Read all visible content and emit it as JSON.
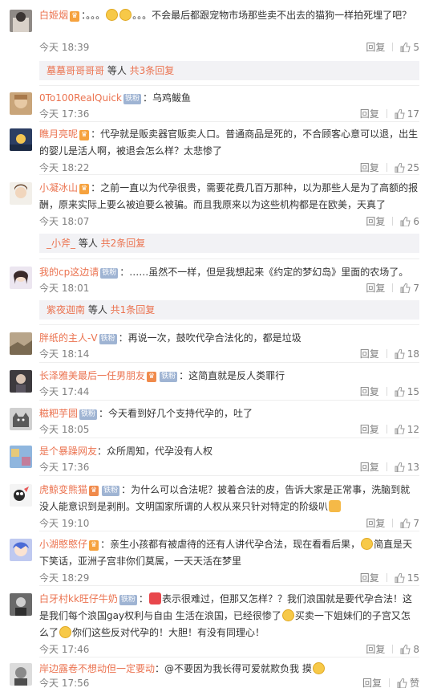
{
  "colors": {
    "username": "#eb7350",
    "meta": "#808080",
    "text": "#333333",
    "subbar_bg": "#f2f2f5"
  },
  "comments": [
    {
      "user": "白姬烟",
      "badge": "",
      "text_parts": [
        "：。。。",
        "。。。不会最后都跟宠物市场那些卖不出去的猫狗一样拍死埋了吧？"
      ],
      "time": "今天 18:39",
      "reply_label": "回复",
      "likes": "5",
      "sub": {
        "user": "墓墓哥哥哥哥",
        "middle": " 等人 ",
        "more": "共3条回复"
      }
    },
    {
      "user": "0To100RealQuick",
      "badge": "铁粉",
      "text": "：乌鸡鲅鱼",
      "time": "今天 17:36",
      "reply_label": "回复",
      "likes": "17"
    },
    {
      "user": "瞧月亮呢",
      "badge": "",
      "text": "：代孕就是贩卖器官贩卖人口。普通商品是死的，不合顾客心意可以退，出生的婴儿是活人啊，被退会怎么样？太悲惨了",
      "time": "今天 18:22",
      "reply_label": "回复",
      "likes": "25"
    },
    {
      "user": "小凝冰山",
      "badge": "",
      "text": "：之前一直以为代孕很贵，需要花费几百万那种，以为那些人是为了高额的报酬，原来实际上要么被迫要么被骗。而且我原来以为这些机构都是在欧美，天真了",
      "time": "今天 18:07",
      "reply_label": "回复",
      "likes": "6",
      "sub": {
        "user": "_小斧_",
        "middle": " 等人 ",
        "more": "共2条回复"
      }
    },
    {
      "user": "我的cp这边请",
      "badge": "铁粉",
      "text": "：……虽然不一样，但是我想起来《约定的梦幻岛》里面的农场了。",
      "time": "今天 18:01",
      "reply_label": "回复",
      "likes": "7",
      "sub": {
        "user": "紫夜迦南",
        "middle": " 等人 ",
        "more": "共1条回复"
      }
    },
    {
      "user": "胖纸的主人-V",
      "badge": "铁粉",
      "text": "：再说一次，鼓吹代孕合法化的，都是垃圾",
      "time": "今天 18:14",
      "reply_label": "回复",
      "likes": "18"
    },
    {
      "user": "长泽雅美最后一任男朋友",
      "badge": "铁粉",
      "text": "：这简直就是反人类罪行",
      "time": "今天 17:44",
      "reply_label": "回复",
      "likes": "15"
    },
    {
      "user": "糍粑芋圆",
      "badge": "铁粉",
      "text": "：今天看到好几个支持代孕的，吐了",
      "time": "今天 18:05",
      "reply_label": "回复",
      "likes": "12"
    },
    {
      "user": "是个暴躁网友",
      "badge": "",
      "text": "：众所周知，代孕没有人权",
      "time": "今天 17:36",
      "reply_label": "回复",
      "likes": "13"
    },
    {
      "user": "虎鲸变熊猫",
      "badge": "铁粉",
      "text": "：为什么可以合法呢？披着合法的皮，告诉大家是正常事，洗脑到就没人能意识到是剥削。文明国家所谓的人权从来只针对特定的阶级叭",
      "time": "今天 19:10",
      "reply_label": "回复",
      "likes": "7"
    },
    {
      "user": "小湖愍愍仔",
      "badge": "",
      "text": "：亲生小孩都有被虐待的还有人讲代孕合法，现在看看后果，",
      "text2": "简直是天下笑话，亚洲子宫非你们莫属，一天天活在梦里",
      "time": "今天 18:29",
      "reply_label": "回复",
      "likes": "15"
    },
    {
      "user": "白牙村kk旺仔牛奶",
      "badge": "铁粉",
      "text": "：",
      "text2": "表示很难过，但那又怎样？？我们浪国就是要代孕合法！这是我们每个浪国gay权利与自由 生活在浪国，已经很惨了",
      "text3": "买卖一下姐妹们的子宫又怎么了",
      "text4": "你们这些反对代孕的！大胆！有没有同理心！",
      "time": "今天 17:46",
      "reply_label": "回复",
      "likes": "8"
    },
    {
      "user": "岸边露卷不想动但一定要动",
      "badge": "",
      "text": "：@不要因为我长得可爱就欺负我 摸",
      "time": "今天 17:56",
      "reply_label": "回复",
      "likes": "赞"
    }
  ]
}
